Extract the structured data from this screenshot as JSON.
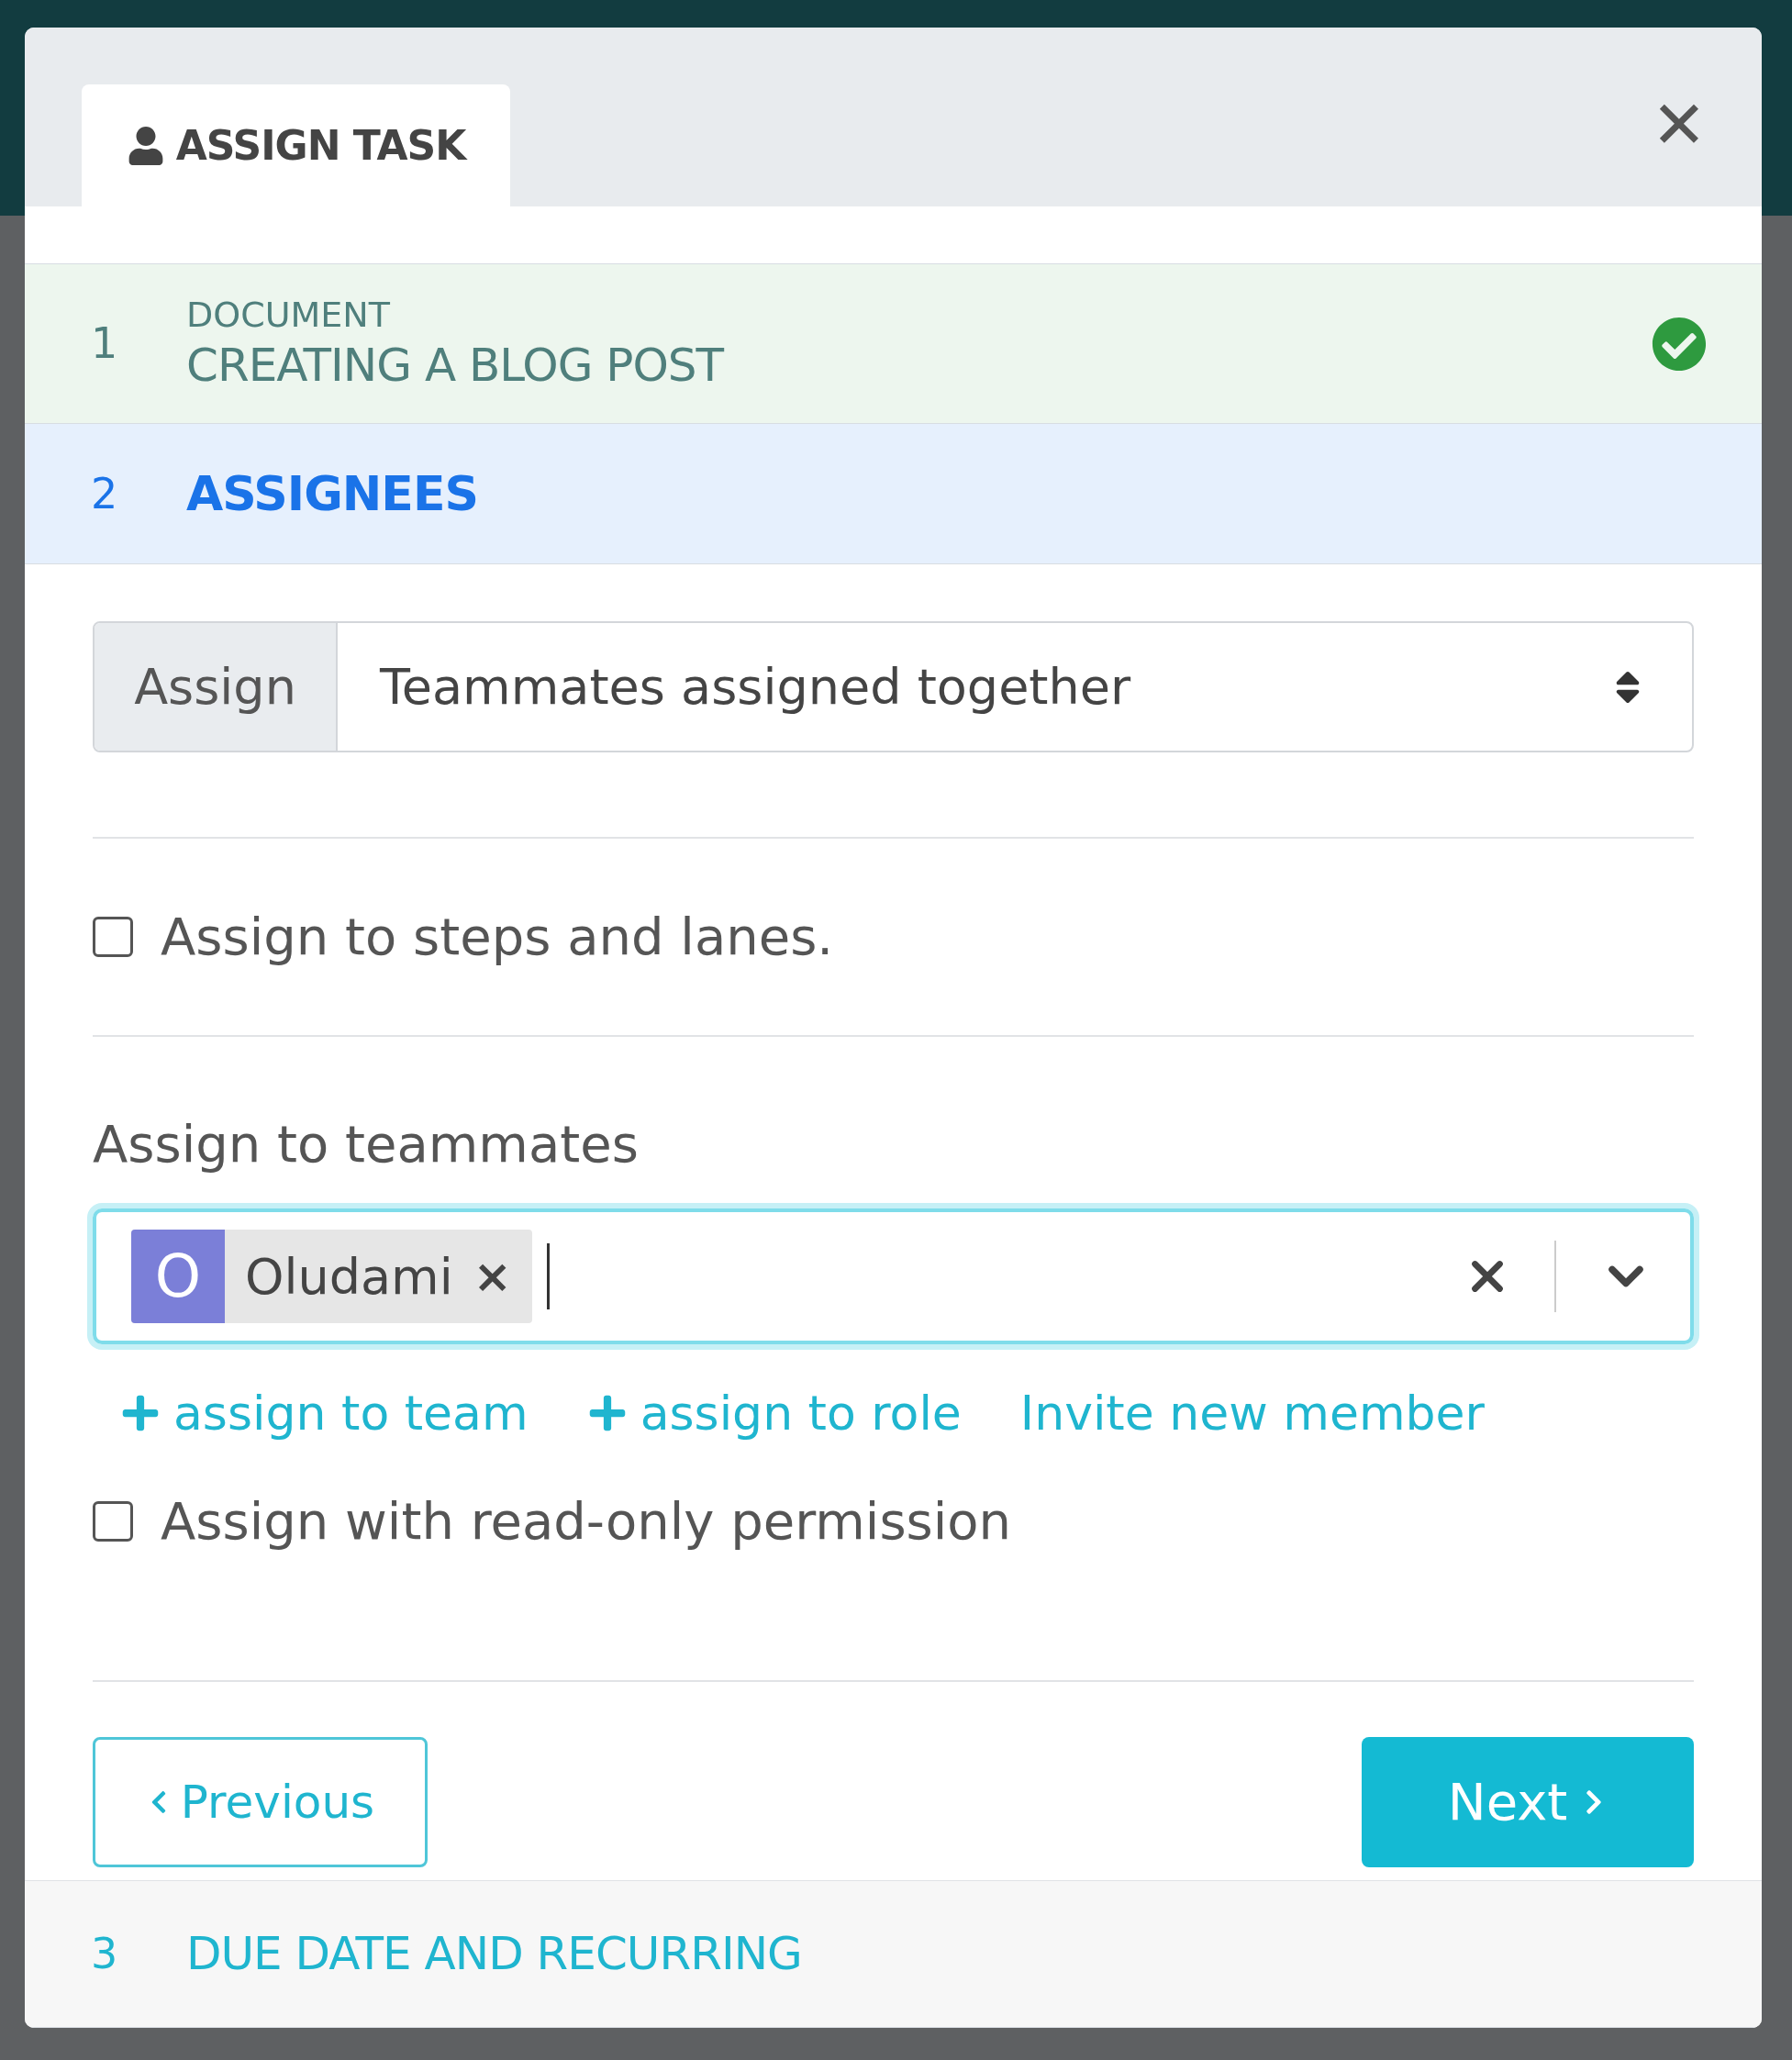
{
  "dialog": {
    "tab": "ASSIGN TASK",
    "close": "✕"
  },
  "steps": [
    {
      "number": "1",
      "label": "DOCUMENT",
      "title": "CREATING A BLOG POST",
      "completed": true,
      "selected": false
    },
    {
      "number": "2",
      "title": "ASSIGNEES",
      "completed": false,
      "selected": true
    }
  ],
  "assign_select": {
    "addon": "Assign",
    "value": "Teammates assigned together"
  },
  "steps_checkbox": {
    "label": "Assign to steps and lanes.",
    "checked": false
  },
  "teammates": {
    "label": "Assign to teammates",
    "tags": [
      {
        "initial": "O",
        "name": "Oludami",
        "remove": "×"
      }
    ]
  },
  "links": [
    {
      "kind": "add",
      "label": "assign to team"
    },
    {
      "kind": "add",
      "label": "assign to role"
    },
    {
      "kind": "plain",
      "label": "Invite new member"
    }
  ],
  "readonly_checkbox": {
    "label": "Assign with read-only permission",
    "checked": false
  },
  "buttons": {
    "previous": "Previous",
    "next": "Next"
  },
  "next_steps": [
    {
      "number": "3",
      "title": "DUE DATE AND RECURRING",
      "completed": false,
      "selected": false
    }
  ]
}
